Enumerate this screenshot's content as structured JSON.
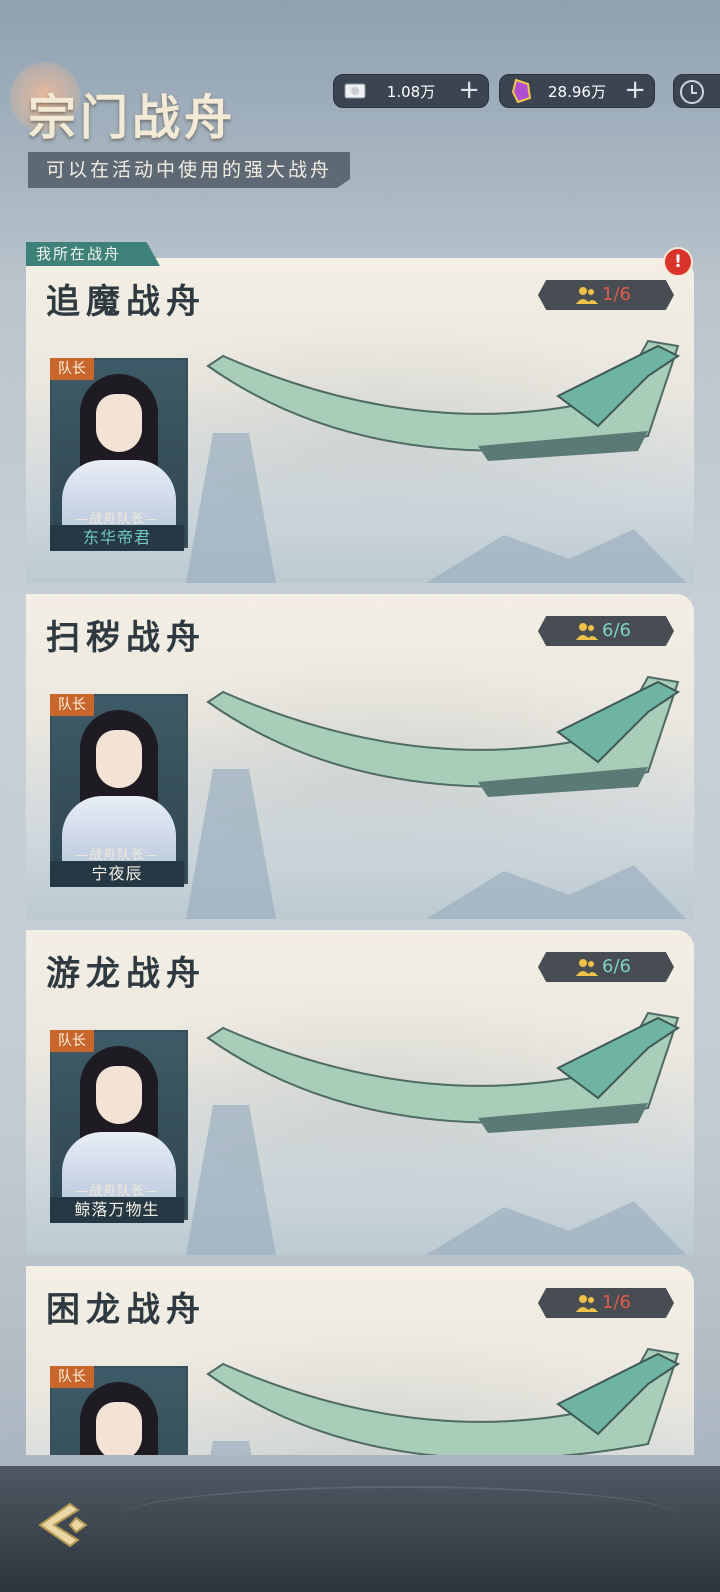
{
  "header": {
    "title": "宗门战舟",
    "subtitle": "可以在活动中使用的强大战舟"
  },
  "currencies": [
    {
      "icon": "silver-coin-icon",
      "value": "1.08万"
    },
    {
      "icon": "purple-jade-icon",
      "value": "28.96万"
    }
  ],
  "current_ship_tag": "我所在战舟",
  "ships": [
    {
      "name": "追魔战舟",
      "count": "1/6",
      "count_color": "#e0584b",
      "captain_tag": "队长",
      "captain_title": "—战舟队长—",
      "captain_name": "东华帝君"
    },
    {
      "name": "扫秽战舟",
      "count": "6/6",
      "count_color": "#7fd0c6",
      "captain_tag": "队长",
      "captain_title": "—战舟队长—",
      "captain_name": "宁夜辰"
    },
    {
      "name": "游龙战舟",
      "count": "6/6",
      "count_color": "#7fd0c6",
      "captain_tag": "队长",
      "captain_title": "—战舟队长—",
      "captain_name": "鲸落万物生"
    },
    {
      "name": "困龙战舟",
      "count": "1/6",
      "count_color": "#e0584b",
      "captain_tag": "队长",
      "captain_title": "",
      "captain_name": ""
    }
  ],
  "colors": {
    "accent_teal": "#3d8178",
    "alert_red": "#d9342a",
    "count_red": "#e0584b",
    "count_teal": "#7fd0c6"
  }
}
